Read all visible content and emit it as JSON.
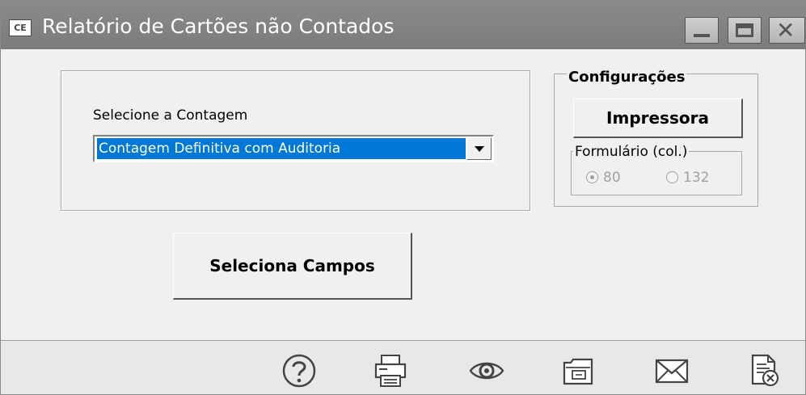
{
  "window": {
    "app_badge": "CE",
    "title": "Relatório de Cartões não Contados",
    "controls": [
      "minimize",
      "maximize",
      "close"
    ]
  },
  "selection": {
    "label": "Selecione a Contagem",
    "selected_value": "Contagem Definitiva com Auditoria"
  },
  "buttons": {
    "select_fields": "Seleciona Campos",
    "printer": "Impressora"
  },
  "configuracoes": {
    "title": "Configurações",
    "formulario_title": "Formulário (col.)",
    "options": [
      {
        "label": "80",
        "selected": true
      },
      {
        "label": "132",
        "selected": false
      }
    ]
  },
  "toolbar": {
    "icons": [
      "help-icon",
      "print-icon",
      "preview-icon",
      "folder-icon",
      "mail-icon",
      "close-report-icon"
    ]
  }
}
